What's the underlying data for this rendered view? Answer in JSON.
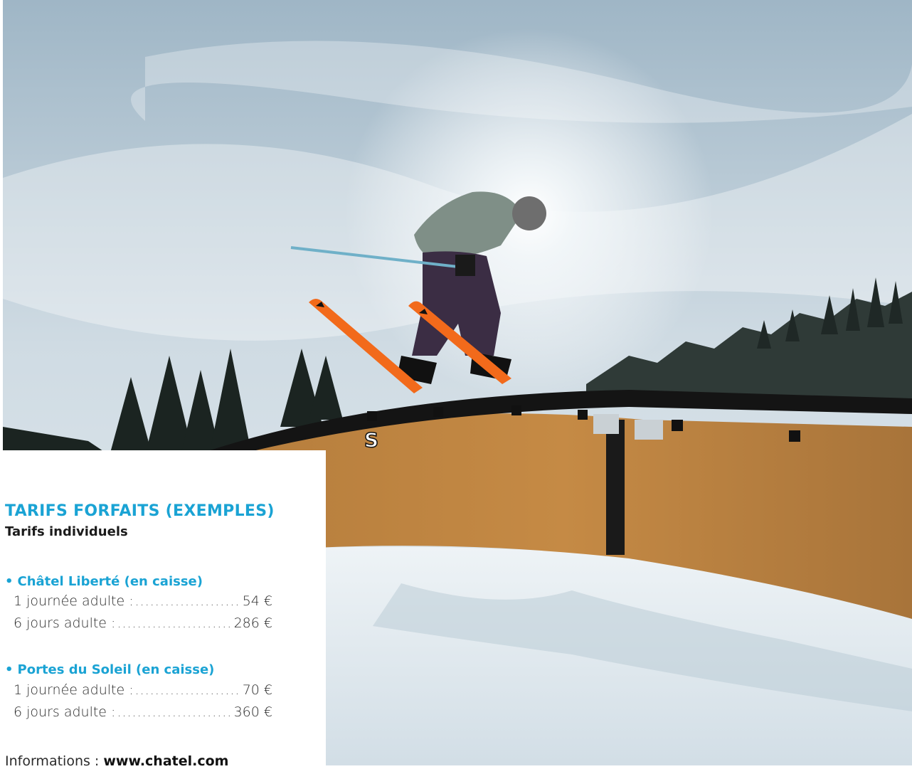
{
  "photo": {
    "subject": "skier-on-rail"
  },
  "panel": {
    "title": "TARIFS FORFAITS (EXEMPLES)",
    "subtitle": "Tarifs individuels",
    "groups": [
      {
        "bullet": "•",
        "title": "Châtel Liberté (en caisse)",
        "rows": [
          {
            "label": "1 journée adulte :",
            "value": "54 €"
          },
          {
            "label": "6 jours adulte :",
            "value": "286 €"
          }
        ]
      },
      {
        "bullet": "•",
        "title": "Portes du Soleil (en caisse)",
        "rows": [
          {
            "label": "1 journée adulte :",
            "value": "70 €"
          },
          {
            "label": "6 jours adulte :",
            "value": "360 €"
          }
        ]
      }
    ],
    "info_label": "Informations : ",
    "info_link": "www.chatel.com"
  },
  "colors": {
    "accent": "#1aa3d4",
    "text": "#2b2b2b"
  }
}
